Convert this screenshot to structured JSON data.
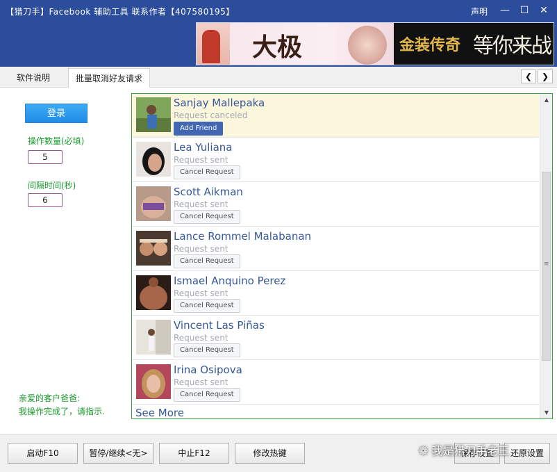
{
  "app": {
    "title": "【猎刀手】Facebook 辅助工具    联系作者【407580195】",
    "statement": "声明",
    "window_controls": {
      "minimize": "—",
      "maximize": "☐",
      "close": "✕"
    }
  },
  "tabs": [
    {
      "label": "软件说明",
      "active": false
    },
    {
      "label": "批量取消好友请求",
      "active": true
    }
  ],
  "tab_nav": {
    "prev": "❮",
    "next": "❯"
  },
  "left_panel": {
    "login_label": "登录",
    "count_label": "操作数量(必填)",
    "count_value": "5",
    "interval_label": "间隔时间(秒)",
    "interval_value": "6",
    "message_line1": "亲爱的客户爸爸:",
    "message_line2": "我操作完成了，请指示."
  },
  "fb_list": {
    "rows": [
      {
        "name": "Sanjay Mallepaka",
        "status": "Request canceled",
        "button": "Add Friend"
      },
      {
        "name": "Lea Yuliana",
        "status": "Request sent",
        "button": "Cancel Request"
      },
      {
        "name": "Scott Aikman",
        "status": "Request sent",
        "button": "Cancel Request"
      },
      {
        "name": "Lance Rommel Malabanan",
        "status": "Request sent",
        "button": "Cancel Request"
      },
      {
        "name": "Ismael Anquino Perez",
        "status": "Request sent",
        "button": "Cancel Request"
      },
      {
        "name": "Vincent Las Piñas",
        "status": "Request sent",
        "button": "Cancel Request"
      },
      {
        "name": "Irina Osipova",
        "status": "Request sent",
        "button": "Cancel Request"
      }
    ],
    "see_more": "See More"
  },
  "banner": {
    "text1": "大极",
    "text2": "金装传奇",
    "text3": "等你来战"
  },
  "bottom": {
    "start": "启动F10",
    "pause": "暂停/继续<无>",
    "stop": "中止F12",
    "hotkey": "修改热键",
    "save": "保存设置",
    "restore": "还原设置",
    "watermark": "我是猎刀手老王"
  },
  "colors": {
    "titlebar": "#2b4d9b",
    "fb_link": "#365899",
    "green_text": "#1a9a2e",
    "login_button": "#1f8de6"
  }
}
